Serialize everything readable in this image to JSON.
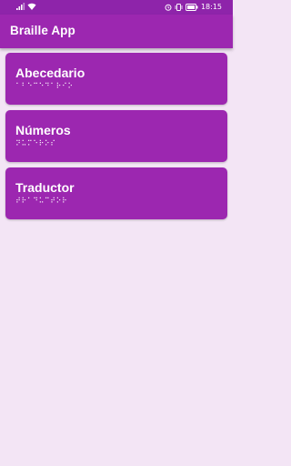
{
  "status_bar": {
    "time": "18:15",
    "icons": [
      "signal-icon",
      "wifi-icon",
      "alarm-icon",
      "vibrate-icon",
      "battery-icon"
    ]
  },
  "app_bar": {
    "title": "Braille App"
  },
  "cards": [
    {
      "title": "Abecedario",
      "braille": "⠁⠃⠑⠉⠑⠙⠁⠗⠊⠕"
    },
    {
      "title": "Números",
      "braille": "⠝⠥⠍⠑⠗⠕⠎"
    },
    {
      "title": "Traductor",
      "braille": "⠞⠗⠁⠙⠥⠉⠞⠕⠗"
    }
  ],
  "colors": {
    "status_bar": "#8e24aa",
    "app_bar": "#9c27b0",
    "card": "#9c27b0",
    "background": "#f3e5f5"
  }
}
